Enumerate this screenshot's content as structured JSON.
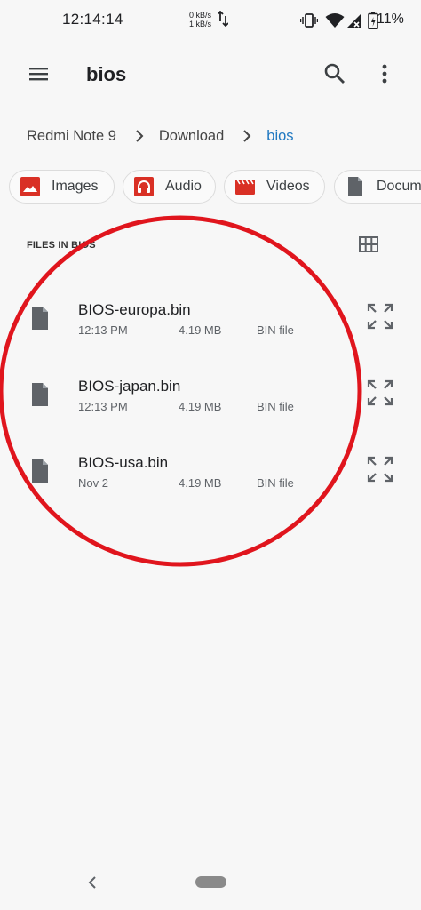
{
  "status_bar": {
    "time": "12:14:14",
    "net_up": "0 kB/s",
    "net_down": "1 kB/s",
    "battery": "11%"
  },
  "toolbar": {
    "title": "bios",
    "menu_icon": "hamburger-menu-icon",
    "search_icon": "search-icon",
    "more_icon": "more-vert-icon"
  },
  "breadcrumb": {
    "items": [
      "Redmi Note 9",
      "Download",
      "bios"
    ]
  },
  "chips": [
    {
      "label": "Images",
      "icon": "image-icon",
      "color": "#d93025"
    },
    {
      "label": "Audio",
      "icon": "headphones-icon",
      "color": "#d93025"
    },
    {
      "label": "Videos",
      "icon": "movie-icon",
      "color": "#d93025"
    },
    {
      "label": "Docum",
      "icon": "document-icon",
      "color": "#5f6368"
    }
  ],
  "section": {
    "title": "FILES IN BIOS"
  },
  "files": [
    {
      "name": "BIOS-europa.bin",
      "date": "12:13 PM",
      "size": "4.19 MB",
      "type": "BIN file"
    },
    {
      "name": "BIOS-japan.bin",
      "date": "12:13 PM",
      "size": "4.19 MB",
      "type": "BIN file"
    },
    {
      "name": "BIOS-usa.bin",
      "date": "Nov 2",
      "size": "4.19 MB",
      "type": "BIN file"
    }
  ],
  "colors": {
    "accent": "#1f78c1",
    "annotation": "#e0151d",
    "chip_icon": "#d93025"
  }
}
